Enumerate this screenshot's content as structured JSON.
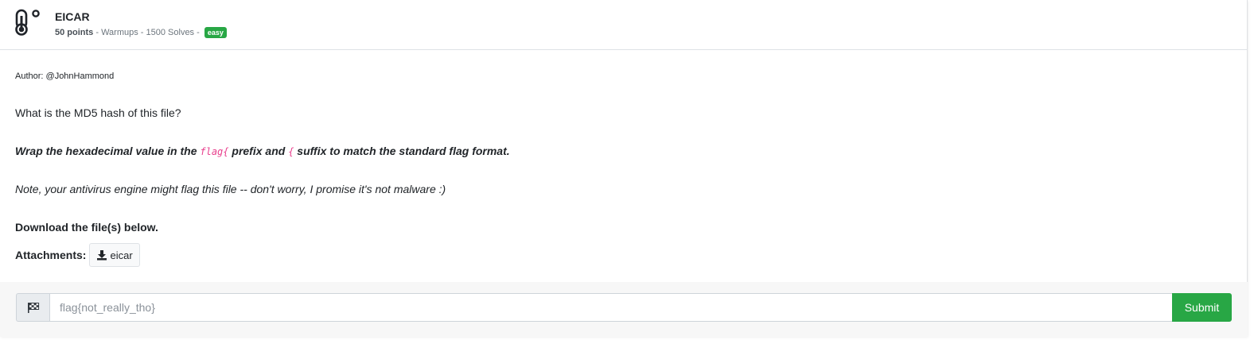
{
  "challenge": {
    "title": "EICAR",
    "points": "50 points",
    "category": "Warmups",
    "solves": "1500 Solves",
    "separator": " - ",
    "difficulty": "easy",
    "icon": "thermometer-icon"
  },
  "description": {
    "author": "Author: @JohnHammond",
    "question": "What is the MD5 hash of this file?",
    "wrap_part1": "Wrap the hexadecimal value in the ",
    "wrap_prefix_code": "flag{",
    "wrap_part2": " prefix and ",
    "wrap_suffix_code": "{",
    "wrap_part3": " suffix to match the standard flag format.",
    "note": "Note, your antivirus engine might flag this file -- don't worry, I promise it's not malware :)",
    "download_text": "Download the file(s) below."
  },
  "attachments": {
    "label": "Attachments:",
    "files": [
      {
        "name": "eicar",
        "icon": "download-icon"
      }
    ]
  },
  "submission": {
    "icon": "checkered-flag-icon",
    "placeholder": "flag{not_really_tho}",
    "value": "",
    "submit_label": "Submit"
  },
  "colors": {
    "success": "#28a745",
    "code": "#e83e8c"
  }
}
